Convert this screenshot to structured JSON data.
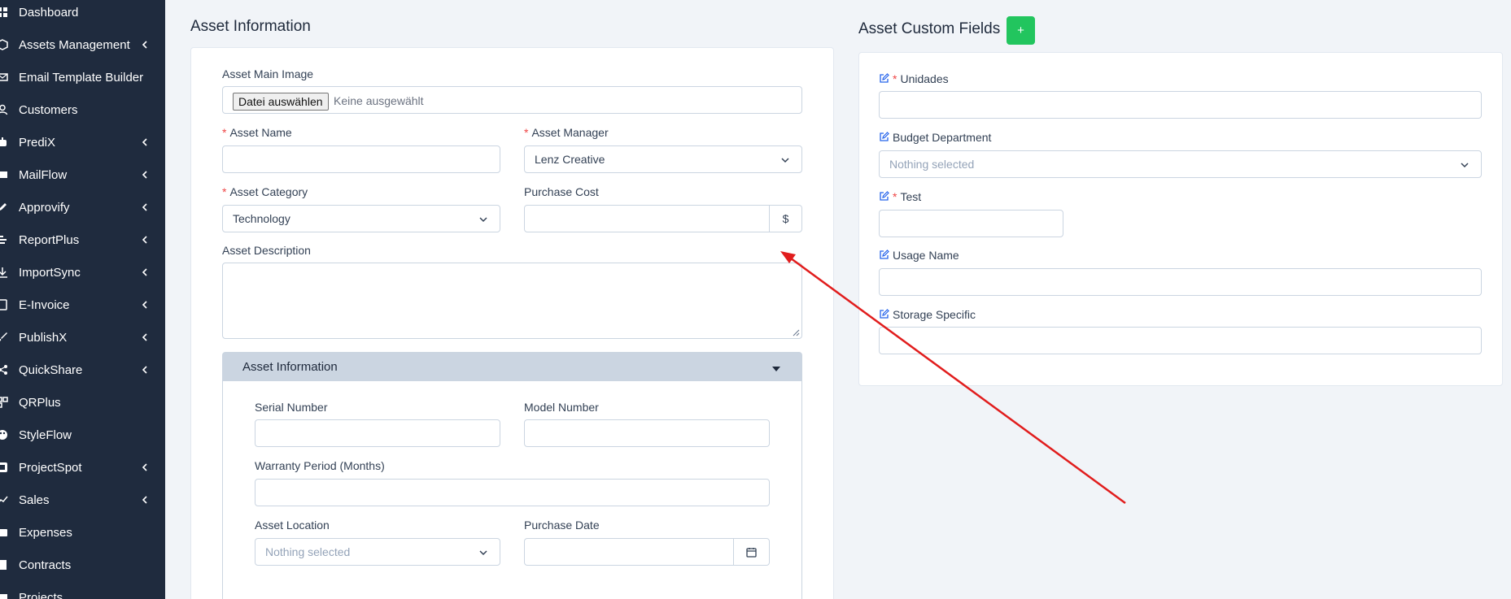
{
  "sidebar": {
    "items": [
      {
        "label": "Dashboard",
        "icon": "dashboard-icon",
        "has_children": false
      },
      {
        "label": "Assets Management",
        "icon": "assets-icon",
        "has_children": true
      },
      {
        "label": "Email Template Builder",
        "icon": "email-template-icon",
        "has_children": false
      },
      {
        "label": "Customers",
        "icon": "user-icon",
        "has_children": false
      },
      {
        "label": "PrediX",
        "icon": "robot-icon",
        "has_children": true
      },
      {
        "label": "MailFlow",
        "icon": "mail-icon",
        "has_children": true
      },
      {
        "label": "Approvify",
        "icon": "pen-icon",
        "has_children": true
      },
      {
        "label": "ReportPlus",
        "icon": "report-icon",
        "has_children": true
      },
      {
        "label": "ImportSync",
        "icon": "import-icon",
        "has_children": true
      },
      {
        "label": "E-Invoice",
        "icon": "invoice-icon",
        "has_children": true
      },
      {
        "label": "PublishX",
        "icon": "brush-icon",
        "has_children": true
      },
      {
        "label": "QuickShare",
        "icon": "share-icon",
        "has_children": true
      },
      {
        "label": "QRPlus",
        "icon": "qr-icon",
        "has_children": false
      },
      {
        "label": "StyleFlow",
        "icon": "palette-icon",
        "has_children": false
      },
      {
        "label": "ProjectSpot",
        "icon": "project-icon",
        "has_children": true
      },
      {
        "label": "Sales",
        "icon": "sales-icon",
        "has_children": true
      },
      {
        "label": "Expenses",
        "icon": "expenses-icon",
        "has_children": false
      },
      {
        "label": "Contracts",
        "icon": "contract-icon",
        "has_children": false
      },
      {
        "label": "Projects",
        "icon": "projects-icon",
        "has_children": false
      }
    ]
  },
  "asset_info": {
    "title": "Asset Information",
    "main_image_label": "Asset Main Image",
    "file_button": "Datei auswählen",
    "file_status": "Keine ausgewählt",
    "asset_name_label": "Asset Name",
    "asset_name_value": "",
    "asset_manager_label": "Asset Manager",
    "asset_manager_value": "Lenz Creative",
    "asset_category_label": "Asset Category",
    "asset_category_value": "Technology",
    "purchase_cost_label": "Purchase Cost",
    "purchase_cost_value": "",
    "currency_symbol": "$",
    "description_label": "Asset Description",
    "description_value": "",
    "required_marker": "*"
  },
  "accordion": {
    "title": "Asset Information",
    "serial_label": "Serial Number",
    "model_label": "Model Number",
    "warranty_label": "Warranty Period (Months)",
    "location_label": "Asset Location",
    "location_placeholder": "Nothing selected",
    "purchase_date_label": "Purchase Date"
  },
  "custom_fields": {
    "title": "Asset Custom Fields",
    "add_label": "+",
    "unidades_label": "Unidades",
    "budget_label": "Budget Department",
    "budget_placeholder": "Nothing selected",
    "test_label": "Test",
    "usage_label": "Usage Name",
    "storage_label": "Storage Specific"
  },
  "colors": {
    "sidebar_bg": "#1f2b3e",
    "accent_green": "#22c55e",
    "required_red": "#ef4444",
    "annotation_arrow": "#e11d1d",
    "edit_icon_blue": "#2563eb"
  }
}
